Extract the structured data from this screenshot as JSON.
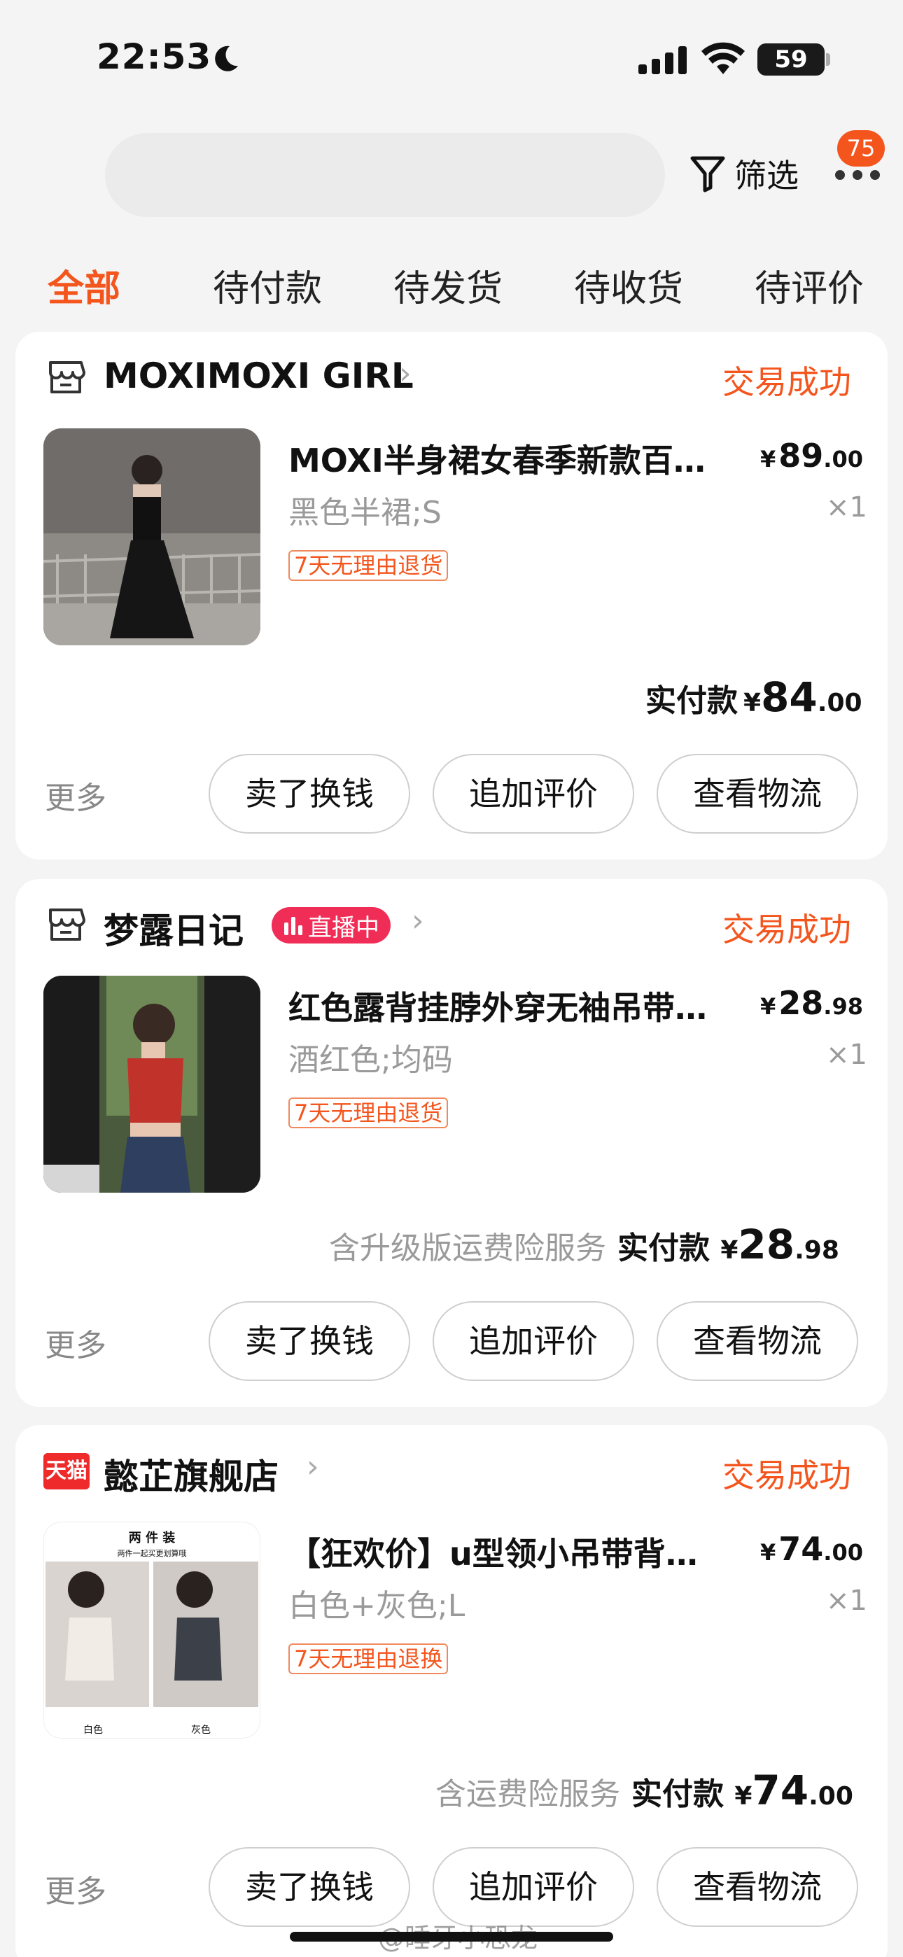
{
  "status_bar": {
    "time": "22:53",
    "battery": "59"
  },
  "header": {
    "filter_label": "筛选",
    "badge": "75"
  },
  "tabs": [
    "全部",
    "待付款",
    "待发货",
    "待收货",
    "待评价"
  ],
  "orders": [
    {
      "shop": "MOXIMOXI GIRL",
      "status": "交易成功",
      "title": "MOXI半身裙女春季新款百…",
      "price_int": "89",
      "price_dec": ".00",
      "spec": "黑色半裙;S",
      "qty": "×1",
      "tag": "7天无理由退货",
      "service": "",
      "paid_label": "实付款",
      "paid_int": "84",
      "paid_dec": ".00",
      "more": "更多",
      "buttons": [
        "卖了换钱",
        "追加评价",
        "查看物流"
      ]
    },
    {
      "shop": "梦露日记",
      "live": "直播中",
      "status": "交易成功",
      "title": "红色露背挂脖外穿无袖吊带…",
      "price_int": "28",
      "price_dec": ".98",
      "spec": "酒红色;均码",
      "qty": "×1",
      "tag": "7天无理由退货",
      "service": "含升级版运费险服务",
      "paid_label": "实付款",
      "paid_int": "28",
      "paid_dec": ".98",
      "more": "更多",
      "buttons": [
        "卖了换钱",
        "追加评价",
        "查看物流"
      ]
    },
    {
      "shop": "懿芷旗舰店",
      "shop_badge": "天猫",
      "status": "交易成功",
      "title": "【狂欢价】u型领小吊带背…",
      "price_int": "74",
      "price_dec": ".00",
      "spec": "白色+灰色;L",
      "qty": "×1",
      "tag": "7天无理由退换",
      "service": "含运费险服务",
      "paid_label": "实付款",
      "paid_int": "74",
      "paid_dec": ".00",
      "more": "更多",
      "buttons": [
        "卖了换钱",
        "追加评价",
        "查看物流"
      ],
      "thumb_text": {
        "top": "两 件 装",
        "sub": "两件一起买更划算哦",
        "left": "白色",
        "right": "灰色"
      }
    }
  ],
  "currency": "¥",
  "watermark": "@睡牙小恐龙",
  "colors": {
    "accent": "#f4551d",
    "live": "#f02d56",
    "tmall": "#ee2a2a"
  }
}
